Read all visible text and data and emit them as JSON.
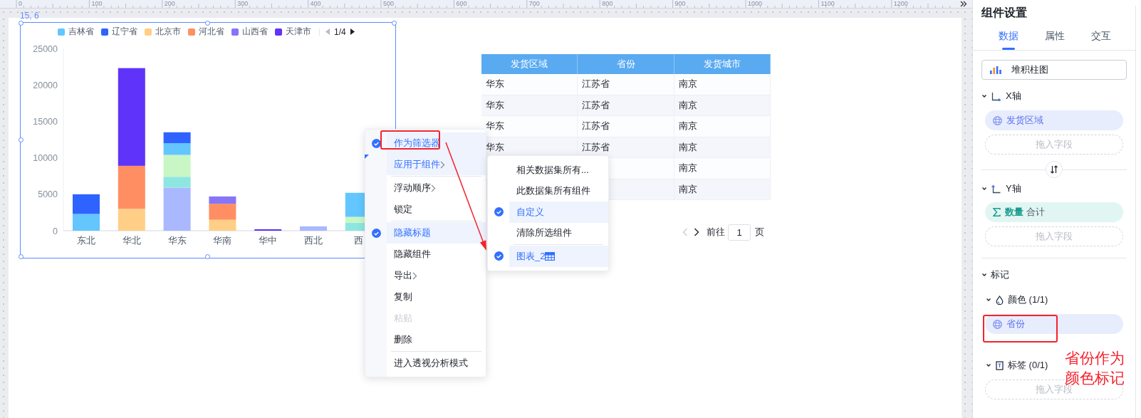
{
  "ruler": {
    "labels": [
      "0",
      "100",
      "200",
      "300",
      "400",
      "500",
      "600",
      "700",
      "800",
      "900",
      "1000",
      "1100",
      "1200"
    ]
  },
  "chart": {
    "position_label": "15, 6",
    "legend_pager": {
      "text": "1/4",
      "prev_disabled": true,
      "next_disabled": false
    },
    "chart_data": {
      "type": "bar",
      "stacked": true,
      "categories": [
        "东北",
        "华北",
        "华东",
        "华南",
        "华中",
        "西北",
        "西"
      ],
      "ylim": [
        0,
        25000
      ],
      "yticks": [
        0,
        5000,
        10000,
        15000,
        20000,
        25000
      ],
      "series": [
        {
          "color": "#a9b8ff",
          "values": [
            0,
            0,
            5900,
            0,
            0,
            600,
            0
          ]
        },
        {
          "color": "#8ee6e0",
          "values": [
            0,
            0,
            1500,
            0,
            0,
            0,
            1100
          ]
        },
        {
          "color": "#c8f7c5",
          "values": [
            0,
            0,
            3000,
            0,
            0,
            0,
            800
          ]
        },
        {
          "name": "吉林省",
          "color": "#63c6ff",
          "values": [
            2300,
            0,
            1600,
            0,
            0,
            0,
            3300
          ]
        },
        {
          "name": "辽宁省",
          "color": "#2f63ff",
          "values": [
            2700,
            0,
            1500,
            0,
            0,
            0,
            0
          ]
        },
        {
          "name": "北京市",
          "color": "#ffcf87",
          "values": [
            0,
            3000,
            0,
            1500,
            0,
            0,
            0
          ]
        },
        {
          "name": "河北省",
          "color": "#ff8f62",
          "values": [
            0,
            5900,
            0,
            2200,
            0,
            0,
            0
          ]
        },
        {
          "name": "山西省",
          "color": "#8676f7",
          "values": [
            0,
            0,
            0,
            1000,
            0,
            0,
            0
          ]
        },
        {
          "name": "天津市",
          "color": "#5f33f8",
          "values": [
            0,
            13400,
            0,
            0,
            200,
            0,
            0
          ]
        }
      ]
    }
  },
  "table": {
    "columns": [
      "发货区域",
      "省份",
      "发货城市"
    ],
    "rows": [
      {
        "region": "华东",
        "province": "江苏省",
        "city": "南京"
      },
      {
        "region": "华东",
        "province": "江苏省",
        "city": "南京"
      },
      {
        "region": "华东",
        "province": "江苏省",
        "city": "南京"
      },
      {
        "region": "华东",
        "province": "江苏省",
        "city": "南京"
      },
      {
        "city": "南京"
      },
      {
        "city": "南京"
      }
    ]
  },
  "pagination": {
    "prev_disabled": true,
    "next_disabled": false,
    "goto_label": "前往",
    "page": "1",
    "page_suffix": "页"
  },
  "context_menu": {
    "items": [
      {
        "kind": "item",
        "label": "作为筛选器",
        "checked": true,
        "selected": true,
        "has_submenu": false,
        "disabled": false,
        "outlined": true
      },
      {
        "kind": "item",
        "label": "应用于组件",
        "checked": false,
        "selected": true,
        "has_submenu": true,
        "disabled": false,
        "outlined": false
      },
      {
        "kind": "divider"
      },
      {
        "kind": "item",
        "label": "浮动顺序",
        "checked": false,
        "selected": false,
        "has_submenu": true,
        "disabled": false,
        "outlined": false
      },
      {
        "kind": "item",
        "label": "锁定",
        "checked": false,
        "selected": false,
        "has_submenu": false,
        "disabled": false,
        "outlined": false
      },
      {
        "kind": "divider"
      },
      {
        "kind": "item",
        "label": "隐藏标题",
        "checked": true,
        "selected": true,
        "has_submenu": false,
        "disabled": false,
        "outlined": false
      },
      {
        "kind": "item",
        "label": "隐藏组件",
        "checked": false,
        "selected": false,
        "has_submenu": false,
        "disabled": false,
        "outlined": false
      },
      {
        "kind": "item",
        "label": "导出",
        "checked": false,
        "selected": false,
        "has_submenu": true,
        "disabled": false,
        "outlined": false
      },
      {
        "kind": "item",
        "label": "复制",
        "checked": false,
        "selected": false,
        "has_submenu": false,
        "disabled": false,
        "outlined": false
      },
      {
        "kind": "item",
        "label": "粘贴",
        "checked": false,
        "selected": false,
        "has_submenu": false,
        "disabled": true,
        "outlined": false
      },
      {
        "kind": "item",
        "label": "删除",
        "checked": false,
        "selected": false,
        "has_submenu": false,
        "disabled": false,
        "outlined": false
      },
      {
        "kind": "divider"
      },
      {
        "kind": "item",
        "label": "进入透视分析模式",
        "checked": false,
        "selected": false,
        "has_submenu": false,
        "disabled": false,
        "outlined": false
      }
    ]
  },
  "submenu": {
    "items": [
      {
        "kind": "item",
        "label": "相关数据集所有...",
        "checked": false,
        "selected": false
      },
      {
        "kind": "item",
        "label": "此数据集所有组件",
        "checked": false,
        "selected": false
      },
      {
        "kind": "item",
        "label": "自定义",
        "checked": true,
        "selected": true
      },
      {
        "kind": "item",
        "label": "清除所选组件",
        "checked": false,
        "selected": false
      },
      {
        "kind": "divider"
      },
      {
        "kind": "component",
        "label": "图表_2",
        "checked": true,
        "selected": true
      }
    ]
  },
  "panel": {
    "title": "组件设置",
    "tabs": [
      {
        "label": "数据",
        "selected": true
      },
      {
        "label": "属性",
        "selected": false
      },
      {
        "label": "交互",
        "selected": false
      }
    ],
    "chart_type": "堆积柱图",
    "x_axis": {
      "label": "X轴",
      "expanded": true,
      "fields": [
        {
          "kind": "dimension",
          "name": "发货区域",
          "outlined": false
        }
      ],
      "drop_hint": "拖入字段"
    },
    "y_axis": {
      "label": "Y轴",
      "expanded": true,
      "fields": [
        {
          "kind": "measure",
          "name": "数量",
          "aggregate": "合计",
          "outlined": false
        }
      ],
      "drop_hint": "拖入字段"
    },
    "marks": {
      "label": "标记",
      "expanded": true,
      "groups": [
        {
          "kind": "color",
          "label": "颜色 (1/1)",
          "expanded": true,
          "fields": [
            {
              "kind": "dimension",
              "name": "省份",
              "outlined": true
            }
          ]
        },
        {
          "kind": "tag",
          "label": "标签 (0/1)",
          "expanded": true,
          "drop_hint": "拖入字段"
        }
      ]
    }
  },
  "annotation": {
    "note": "省份作为颜色标记"
  }
}
